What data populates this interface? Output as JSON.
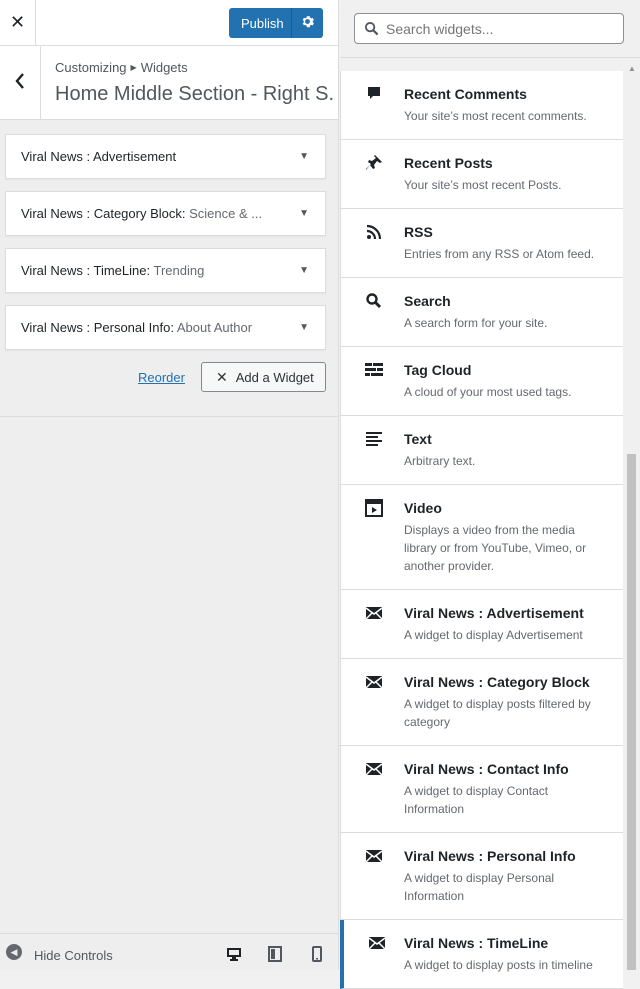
{
  "topbar": {
    "publish_label": "Publish"
  },
  "header": {
    "breadcrumb_root": "Customizing",
    "breadcrumb_current": "Widgets",
    "section_title": "Home Middle Section - Right S..."
  },
  "area_widgets": [
    {
      "name": "Viral News : Advertisement",
      "sub": ""
    },
    {
      "name": "Viral News : Category Block:",
      "sub": "Science & ..."
    },
    {
      "name": "Viral News : TimeLine:",
      "sub": "Trending"
    },
    {
      "name": "Viral News : Personal Info:",
      "sub": "About Author"
    }
  ],
  "actions": {
    "reorder_label": "Reorder",
    "add_widget_label": "Add a Widget"
  },
  "footer": {
    "hide_controls_label": "Hide Controls"
  },
  "search": {
    "placeholder": "Search widgets..."
  },
  "available_widgets": [
    {
      "icon": "comment-icon",
      "name": "Recent Comments",
      "desc": "Your site’s most recent comments."
    },
    {
      "icon": "pin-icon",
      "name": "Recent Posts",
      "desc": "Your site’s most recent Posts."
    },
    {
      "icon": "rss-icon",
      "name": "RSS",
      "desc": "Entries from any RSS or Atom feed."
    },
    {
      "icon": "search-icon",
      "name": "Search",
      "desc": "A search form for your site."
    },
    {
      "icon": "tag-cloud-icon",
      "name": "Tag Cloud",
      "desc": "A cloud of your most used tags."
    },
    {
      "icon": "text-icon",
      "name": "Text",
      "desc": "Arbitrary text."
    },
    {
      "icon": "video-icon",
      "name": "Video",
      "desc": "Displays a video from the media library or from YouTube, Vimeo, or another provider."
    },
    {
      "icon": "envelope-icon",
      "name": "Viral News : Advertisement",
      "desc": "A widget to display Advertisement"
    },
    {
      "icon": "envelope-icon",
      "name": "Viral News : Category Block",
      "desc": "A widget to display posts filtered by category"
    },
    {
      "icon": "envelope-icon",
      "name": "Viral News : Contact Info",
      "desc": "A widget to display Contact Information"
    },
    {
      "icon": "envelope-icon",
      "name": "Viral News : Personal Info",
      "desc": "A widget to display Personal Information"
    },
    {
      "icon": "envelope-icon",
      "name": "Viral News : TimeLine",
      "desc": "A widget to display posts in timeline"
    }
  ],
  "colors": {
    "accent": "#2271b1",
    "panel_bg": "#eeeeee"
  }
}
